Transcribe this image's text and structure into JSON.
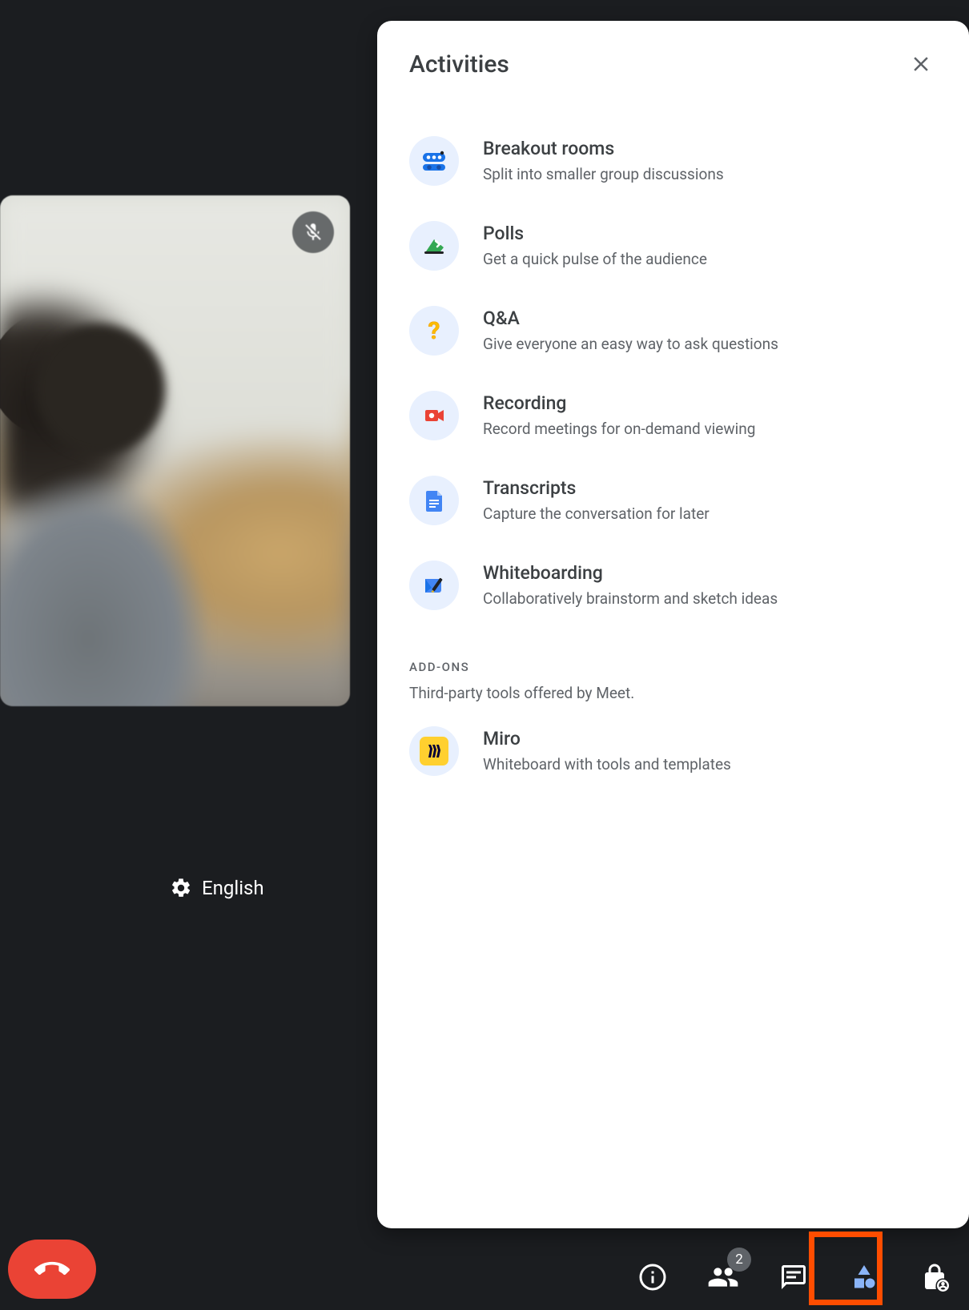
{
  "panel": {
    "title": "Activities"
  },
  "activities": [
    {
      "title": "Breakout rooms",
      "desc": "Split into smaller group discussions"
    },
    {
      "title": "Polls",
      "desc": "Get a quick pulse of the audience"
    },
    {
      "title": "Q&A",
      "desc": "Give everyone an easy way to ask questions"
    },
    {
      "title": "Recording",
      "desc": "Record meetings for on-demand viewing"
    },
    {
      "title": "Transcripts",
      "desc": "Capture the conversation for later"
    },
    {
      "title": "Whiteboarding",
      "desc": "Collaboratively brainstorm and sketch ideas"
    }
  ],
  "addons": {
    "label": "ADD-ONS",
    "sub": "Third-party tools offered by Meet.",
    "items": [
      {
        "title": "Miro",
        "desc": "Whiteboard with tools and templates"
      }
    ]
  },
  "language": {
    "label": "English"
  },
  "bottom": {
    "participants_badge": "2"
  }
}
